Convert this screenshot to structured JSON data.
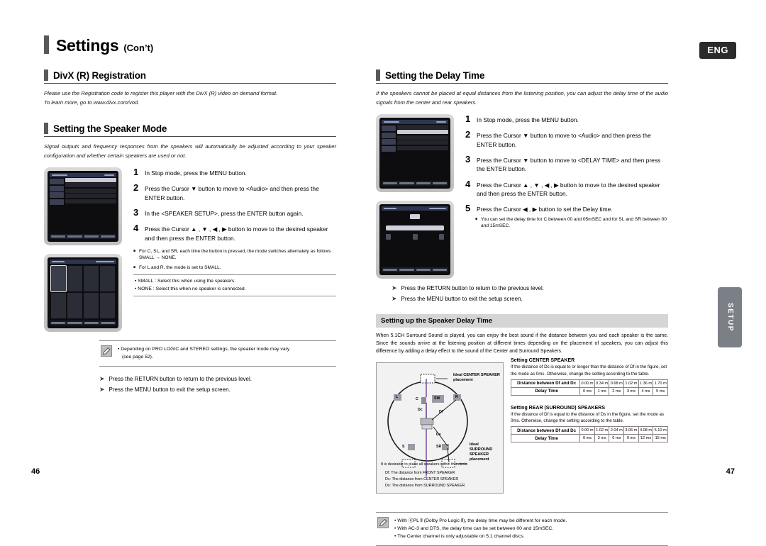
{
  "header": {
    "title_main": "Settings",
    "title_sub": "(Con’t)",
    "language_badge": "ENG"
  },
  "left_column": {
    "section1": {
      "title": "DivX (R) Registration",
      "intro_line1": "Please use the Registration code to register this player with the DivX (R) video on demand format.",
      "intro_line2": "To learn more, go to www.divx.com/vod."
    },
    "section2": {
      "title": "Setting the Speaker Mode",
      "intro": "Signal outputs and frequency responses from the speakers will automatically be adjusted according to your speaker configuration and whether certain speakers are used or not.",
      "steps": [
        {
          "num": "1",
          "text": "In Stop mode, press the MENU button."
        },
        {
          "num": "2",
          "text": "Press the Cursor ▼ button to move to <Audio> and then press the ENTER button."
        },
        {
          "num": "3",
          "text": "In the <SPEAKER SETUP>, press the ENTER button again."
        },
        {
          "num": "4",
          "text": "Press the Cursor ▲ , ▼ , ◀ , ▶ button to move to the desired speaker and then press the ENTER button."
        }
      ],
      "sub_bullets": [
        "For C, SL, and SR, each time the button is pressed, the mode switches alternately as follows : SMALL → NONE.",
        "For L and R, the mode is set to SMALL."
      ],
      "definitions": [
        "• SMALL : Select this when using the speakers.",
        "• NONE : Select this when no speaker is connected."
      ],
      "note_lines": [
        "• Depending on PRO LOGIC and STEREO settings, the speaker mode may vary",
        "(see page 52)."
      ],
      "arrow_lines": [
        "Press the RETURN button to return to the previous level.",
        "Press the MENU button to exit the setup screen."
      ]
    }
  },
  "right_column": {
    "section1": {
      "title": "Setting the Delay Time",
      "intro": "If the speakers cannot be placed at equal distances from the listening position, you can adjust the delay time of the audio signals from the center and rear speakers.",
      "steps": [
        {
          "num": "1",
          "text": "In Stop mode, press the MENU button."
        },
        {
          "num": "2",
          "text": "Press the Cursor ▼ button to move to <Audio> and then press the ENTER button."
        },
        {
          "num": "3",
          "text": "Press the Cursor ▼ button to move to <DELAY TIME> and then press the ENTER button."
        },
        {
          "num": "4",
          "text": "Press the Cursor ▲ , ▼ , ◀ , ▶ button to move to the desired speaker and then press the ENTER button."
        },
        {
          "num": "5",
          "text": "Press the Cursor ◀ , ▶ button to set the Delay time."
        }
      ],
      "sub_bullets": [
        "You can set the delay time for C between 00 and 05mSEC and for SL and SR between 00 and 15mSEC."
      ],
      "arrow_lines": [
        "Press the RETURN button to return to the previous level.",
        "Press the MENU button to exit the setup screen."
      ]
    },
    "banner": {
      "heading": "Setting up the Speaker Delay Time",
      "body": "When 5.1CH Surround Sound is played, you can enjoy the best sound if the distance between you and each speaker is the same. Since the sounds arrive at the listening position at different times depending on the placement of speakers, you can adjust this difference by adding a delay effect to the sound of the Center and Surround Speakers."
    },
    "diagram": {
      "label_center_1": "Ideal CENTER SPEAKER",
      "label_center_2": "placement",
      "label_surround_1": "Ideal",
      "label_surround_2": "SURROUND",
      "label_surround_3": "SPEAKER",
      "label_surround_4": "placement",
      "speakers": {
        "left": "L",
        "right": "R",
        "center": "C",
        "subwoofer": "SW",
        "surround_left": "S",
        "surround_left_sub": "L",
        "surround_right": "SR"
      },
      "distances": {
        "dc": "Dc",
        "df": "Df",
        "ds": "Ds"
      },
      "caption_main": "It is desirable to place all speakers within this circle.",
      "caption_df": "Df: The distance from FRONT SPEAKER",
      "caption_dc": "Dc: The distance from CENTER SPEAKER",
      "caption_ds": "Ds: The distance from SURROUND SPEAKER"
    },
    "table_center": {
      "heading": "Setting CENTER SPEAKER",
      "description": "If the distance of Dc is equal to or longer than the distance of Df in the figure, set the mode as 0ms. Otherwise, change the setting according to the table.",
      "row1_label": "Distance between Df and Dc",
      "row1_values": [
        "0.00 m",
        "0.34 m",
        "0.68 m",
        "1.02 m",
        "1.36 m",
        "1.70 m"
      ],
      "row2_label": "Delay Time",
      "row2_values": [
        "0 ms",
        "1 ms",
        "2 ms",
        "3 ms",
        "4 ms",
        "5 ms"
      ]
    },
    "table_rear": {
      "heading": "Setting REAR (SURROUND) SPEAKERS",
      "description": "If the distance of Df is equal to the distance of Ds in the figure, set the mode as 0ms. Otherwise, change the setting according to the table.",
      "row1_label": "Distance between Df and Dc",
      "row1_values": [
        "0.00 m",
        "1.02 m",
        "2.04 m",
        "3.06 m",
        "4.08 m",
        "5.10 m"
      ],
      "row2_label": "Delay Time",
      "row2_values": [
        "0 ms",
        "3 ms",
        "6 ms",
        "9 ms",
        "12 ms",
        "15 ms"
      ]
    },
    "note_lines": [
      "• With ⓓPL Ⅱ  (Dolby Pro Logic Ⅱ), the delay time may be different for each mode.",
      "• With AC-3 and DTS, the delay time can be set between 00 and 15mSEC.",
      "• The Center channel is only adjustable on 5.1 channel discs."
    ]
  },
  "side_tab": {
    "label": "SETUP"
  },
  "page_numbers": {
    "left": "46",
    "right": "47"
  }
}
